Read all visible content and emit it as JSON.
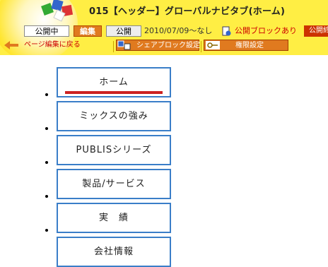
{
  "header": {
    "page_title": "015【ヘッダー】グローバルナビタブ(ホーム)",
    "status": {
      "public_label": "公開中",
      "edit_label": "編集",
      "publish_label": "公開",
      "date_range": "2010/07/09～なし",
      "block_label": "公開ブロックあり",
      "right_badge": "公開終"
    },
    "toolbar": {
      "back_label": "ページ編集に戻る",
      "share_block_label": "シェアブロック設定",
      "permission_label": "権限設定"
    }
  },
  "nav": {
    "items": [
      {
        "label": "ホーム",
        "active": true
      },
      {
        "label": "ミックスの強み",
        "active": false
      },
      {
        "label": "PUBLISシリーズ",
        "active": false
      },
      {
        "label": "製品/サービス",
        "active": false
      },
      {
        "label": "実　績",
        "active": false
      },
      {
        "label": "会社情報",
        "active": false
      }
    ]
  },
  "colors": {
    "header_bg": "#ffee44",
    "accent_orange": "#e07a1f",
    "tab_border": "#3a7ec8",
    "active_underline": "#cc2222",
    "alert_red": "#cc0000"
  }
}
